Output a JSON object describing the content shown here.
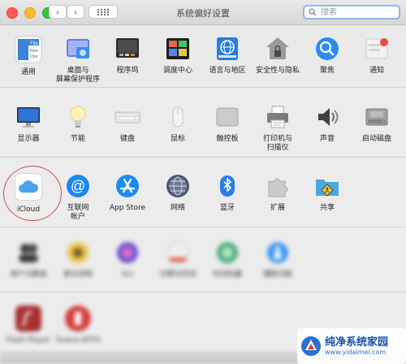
{
  "window": {
    "title": "系统偏好设置",
    "search_placeholder": "搜索"
  },
  "sections": {
    "personal": [
      {
        "id": "general",
        "label": "通用",
        "icon": "general-icon",
        "color": "#3a83d6"
      },
      {
        "id": "desktop",
        "label": "桌面与\n屏幕保护程序",
        "icon": "desktop-screensaver-icon",
        "color": "#7f7fe6"
      },
      {
        "id": "dock",
        "label": "程序坞",
        "icon": "dock-icon",
        "color": "#3a3a3a"
      },
      {
        "id": "mission",
        "label": "调度中心",
        "icon": "mission-control-icon",
        "color": "#2b2b2b"
      },
      {
        "id": "language",
        "label": "语言与地区",
        "icon": "language-region-icon",
        "color": "#2a7be0"
      },
      {
        "id": "security",
        "label": "安全性与隐私",
        "icon": "security-privacy-icon",
        "color": "#8a8a8a"
      },
      {
        "id": "spotlight",
        "label": "聚焦",
        "icon": "spotlight-icon",
        "color": "#2a8cf2"
      },
      {
        "id": "notifications",
        "label": "通知",
        "icon": "notifications-icon",
        "color": "#e8e8e8"
      }
    ],
    "hardware": [
      {
        "id": "displays",
        "label": "显示器",
        "icon": "displays-icon",
        "color": "#2a6ec8"
      },
      {
        "id": "energy",
        "label": "节能",
        "icon": "energy-saver-icon",
        "color": "#f0e48a"
      },
      {
        "id": "keyboard",
        "label": "键盘",
        "icon": "keyboard-icon",
        "color": "#dcdcdc"
      },
      {
        "id": "mouse",
        "label": "鼠标",
        "icon": "mouse-icon",
        "color": "#e4e4e4"
      },
      {
        "id": "trackpad",
        "label": "触控板",
        "icon": "trackpad-icon",
        "color": "#c4c4c4"
      },
      {
        "id": "printers",
        "label": "打印机与\n扫描仪",
        "icon": "printers-scanners-icon",
        "color": "#8a8a8a"
      },
      {
        "id": "sound",
        "label": "声音",
        "icon": "sound-icon",
        "color": "#4a4a4a"
      },
      {
        "id": "startup",
        "label": "启动磁盘",
        "icon": "startup-disk-icon",
        "color": "#9a9a9a"
      }
    ],
    "internet": [
      {
        "id": "icloud",
        "label": "iCloud",
        "icon": "icloud-icon",
        "color": "#4aa3f0"
      },
      {
        "id": "internet_accounts",
        "label": "互联网\n帐户",
        "icon": "internet-accounts-icon",
        "color": "#1b86f0"
      },
      {
        "id": "appstore",
        "label": "App Store",
        "icon": "app-store-icon",
        "color": "#1a8cf5"
      },
      {
        "id": "network",
        "label": "网络",
        "icon": "network-icon",
        "color": "#55607a"
      },
      {
        "id": "bluetooth",
        "label": "蓝牙",
        "icon": "bluetooth-icon",
        "color": "#2b7de9"
      },
      {
        "id": "extensions",
        "label": "扩展",
        "icon": "extensions-icon",
        "color": "#c9c9c9"
      },
      {
        "id": "sharing",
        "label": "共享",
        "icon": "sharing-icon",
        "color": "#4aa8e0"
      }
    ],
    "system": [
      {
        "id": "users",
        "label": "用户与群组",
        "icon": "users-groups-icon",
        "color": "#2a2a2a"
      },
      {
        "id": "parental",
        "label": "家长控制",
        "icon": "parental-controls-icon",
        "color": "#e8c23a"
      },
      {
        "id": "siri",
        "label": "Siri",
        "icon": "siri-icon",
        "color": "#6b4bd6"
      },
      {
        "id": "datetime",
        "label": "日期与时间",
        "icon": "date-time-icon",
        "color": "#e4e4e4"
      },
      {
        "id": "timemachine",
        "label": "时间机器",
        "icon": "time-machine-icon",
        "color": "#3aa46a"
      },
      {
        "id": "accessibility",
        "label": "辅助功能",
        "icon": "accessibility-icon",
        "color": "#2a8cf2"
      }
    ],
    "other": [
      {
        "id": "flash",
        "label": "Flash Player",
        "icon": "flash-player-icon",
        "color": "#a01c1c"
      },
      {
        "id": "tuxera",
        "label": "Tuxera NTFS",
        "icon": "tuxera-ntfs-icon",
        "color": "#d42c2c"
      }
    ]
  },
  "watermark": {
    "title": "纯净系统家园",
    "url": "www.yidaimei.com"
  }
}
